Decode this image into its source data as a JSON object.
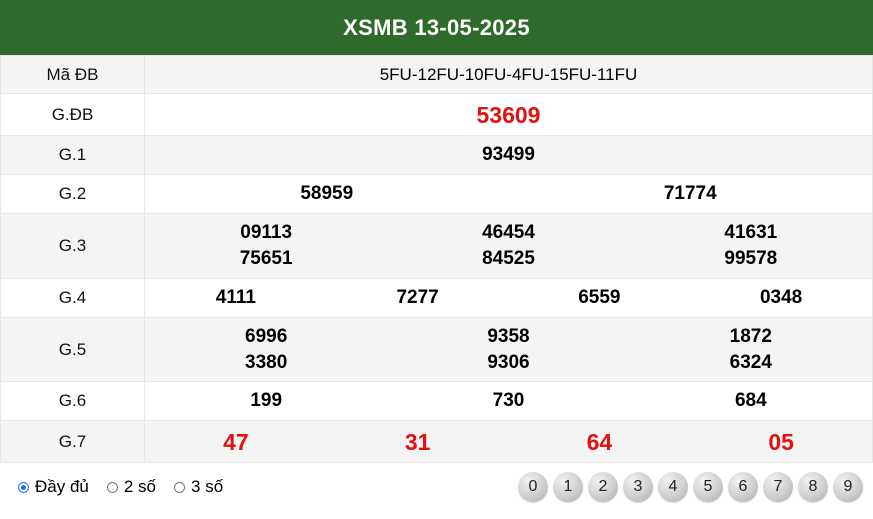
{
  "header": {
    "title": "XSMB 13-05-2025"
  },
  "rows": {
    "ma_db": {
      "label": "Mã ĐB",
      "value": "5FU-12FU-10FU-4FU-15FU-11FU"
    },
    "g_db": {
      "label": "G.ĐB",
      "value": "53609"
    },
    "g1": {
      "label": "G.1",
      "values": [
        "93499"
      ]
    },
    "g2": {
      "label": "G.2",
      "values": [
        "58959",
        "71774"
      ]
    },
    "g3": {
      "label": "G.3",
      "values": [
        "09113",
        "46454",
        "41631",
        "75651",
        "84525",
        "99578"
      ]
    },
    "g4": {
      "label": "G.4",
      "values": [
        "4111",
        "7277",
        "6559",
        "0348"
      ]
    },
    "g5": {
      "label": "G.5",
      "values": [
        "6996",
        "9358",
        "1872",
        "3380",
        "9306",
        "6324"
      ]
    },
    "g6": {
      "label": "G.6",
      "values": [
        "199",
        "730",
        "684"
      ]
    },
    "g7": {
      "label": "G.7",
      "values": [
        "47",
        "31",
        "64",
        "05"
      ]
    }
  },
  "footer": {
    "options": [
      {
        "label": "Đầy đủ",
        "checked": true
      },
      {
        "label": "2 số",
        "checked": false
      },
      {
        "label": "3 số",
        "checked": false
      }
    ],
    "digits": [
      "0",
      "1",
      "2",
      "3",
      "4",
      "5",
      "6",
      "7",
      "8",
      "9"
    ]
  },
  "colors": {
    "header_bg": "#2e6b2b",
    "highlight_red": "#e0110f",
    "radio_accent": "#1a73e8"
  }
}
